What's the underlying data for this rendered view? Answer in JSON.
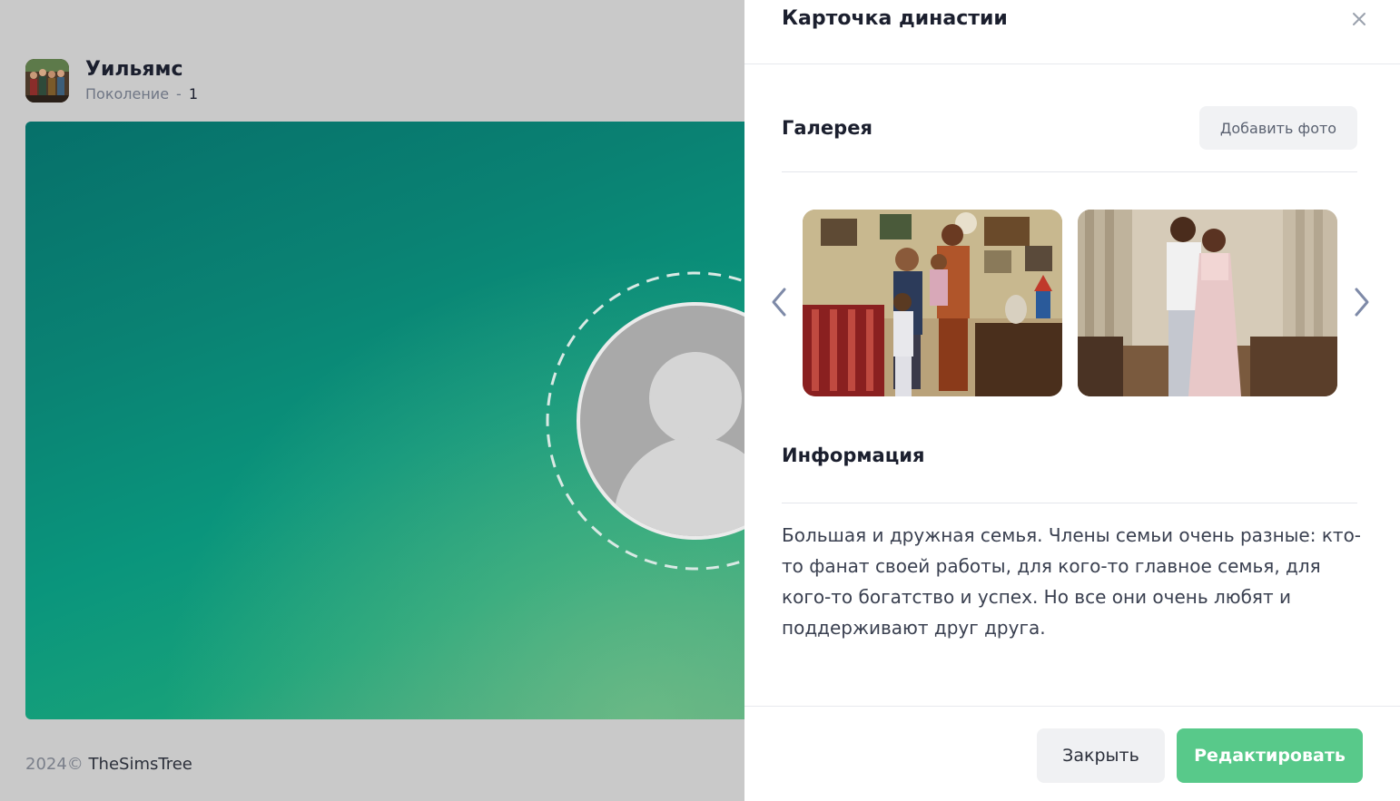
{
  "family": {
    "name": "Уильямс",
    "generation_label": "Поколение",
    "generation_separator": "-",
    "generation_value": "1"
  },
  "footer": {
    "year": "2024©",
    "brand": "TheSimsTree"
  },
  "drawer": {
    "title": "Карточка династии",
    "close_icon": "close-icon",
    "gallery": {
      "title": "Галерея",
      "add_photo_label": "Добавить фото",
      "prev_icon": "chevron-left-icon",
      "next_icon": "chevron-right-icon"
    },
    "info": {
      "title": "Информация",
      "text": "Большая и дружная семья. Члены семьи очень разные: кто-то фанат своей работы, для кого-то главное семья, для кого-то богатство и успех. Но все они очень любят и поддерживают друг друга."
    },
    "actions": {
      "close_label": "Закрыть",
      "edit_label": "Редактировать"
    }
  },
  "colors": {
    "accent_green": "#58c98a",
    "canvas_teal": "#0a8273",
    "overlay_gray": "#c9c9c9"
  }
}
